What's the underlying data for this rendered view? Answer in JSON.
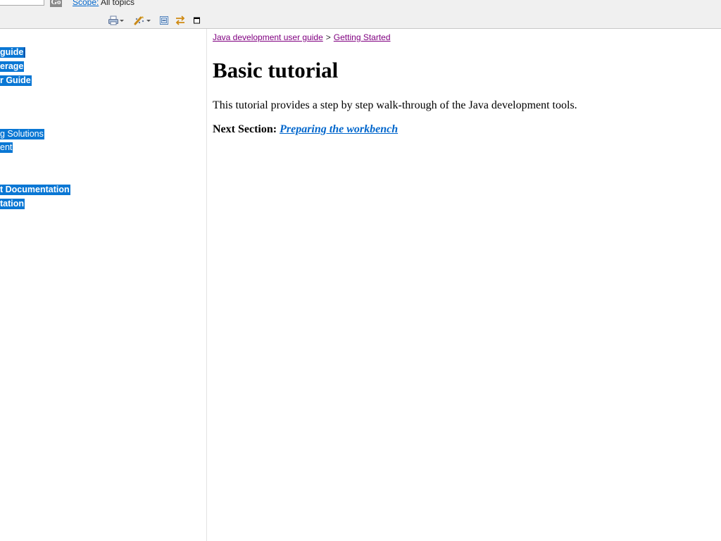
{
  "search": {
    "go_label": "Go",
    "scope_label": "Scope:",
    "scope_value": "All topics"
  },
  "toolbar": {
    "icons": [
      "print-icon",
      "dropdown-arrow-icon",
      "highlight-search-icon",
      "dropdown-arrow-icon",
      "collapse-all-icon",
      "link-with-contents-icon",
      "maximize-icon"
    ]
  },
  "toc": {
    "items": [
      "guide",
      "erage",
      "r Guide",
      "g Solutions",
      "ent",
      "t Documentation",
      "tation"
    ]
  },
  "content": {
    "breadcrumb": {
      "items": [
        "Java development user guide",
        "Getting Started"
      ],
      "separator": ">"
    },
    "title": "Basic tutorial",
    "intro": "This tutorial provides a step by step walk-through of the Java development tools.",
    "next_label": "Next Section:",
    "next_link": "Preparing the workbench"
  },
  "colors": {
    "selection": "#0a77d4",
    "link": "#0066cc",
    "visited_link": "#800080"
  }
}
